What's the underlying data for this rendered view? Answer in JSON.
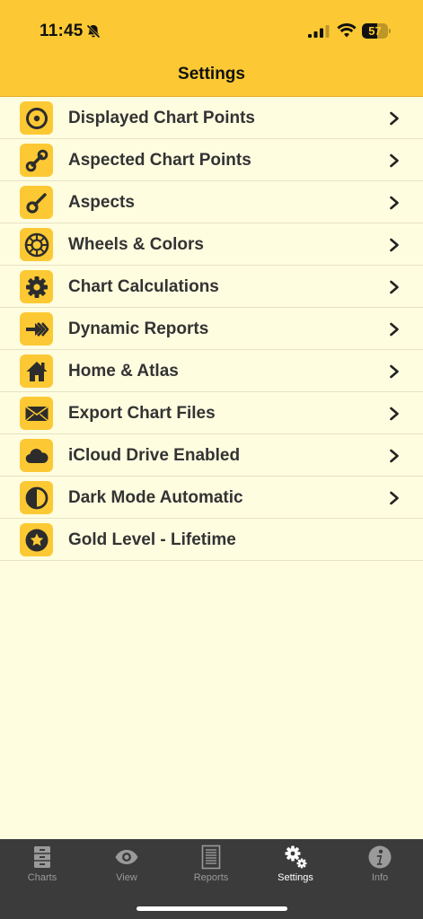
{
  "status_bar": {
    "time": "11:45",
    "battery": "57",
    "battery_level": 0.57,
    "icons": [
      "bell-slash-icon",
      "cellular-signal-icon",
      "wifi-icon",
      "battery-icon"
    ]
  },
  "header": {
    "title": "Settings"
  },
  "settings_items": [
    {
      "label": "Displayed Chart Points",
      "icon": "target-circle-icon",
      "has_chevron": true
    },
    {
      "label": "Aspected Chart Points",
      "icon": "linked-points-icon",
      "has_chevron": true
    },
    {
      "label": "Aspects",
      "icon": "aspect-line-icon",
      "has_chevron": true
    },
    {
      "label": "Wheels & Colors",
      "icon": "wheel-icon",
      "has_chevron": true
    },
    {
      "label": "Chart Calculations",
      "icon": "gear-icon",
      "has_chevron": true
    },
    {
      "label": "Dynamic Reports",
      "icon": "fast-forward-arrow-icon",
      "has_chevron": true
    },
    {
      "label": "Home & Atlas",
      "icon": "house-icon",
      "has_chevron": true
    },
    {
      "label": "Export Chart Files",
      "icon": "envelope-icon",
      "has_chevron": true
    },
    {
      "label": "iCloud Drive Enabled",
      "icon": "cloud-icon",
      "has_chevron": true
    },
    {
      "label": "Dark Mode Automatic",
      "icon": "half-circle-icon",
      "has_chevron": true
    },
    {
      "label": "Gold Level - Lifetime",
      "icon": "star-badge-icon",
      "has_chevron": false
    }
  ],
  "tab_bar": {
    "tabs": [
      {
        "label": "Charts",
        "icon": "file-cabinet-icon",
        "active": false
      },
      {
        "label": "View",
        "icon": "eye-icon",
        "active": false
      },
      {
        "label": "Reports",
        "icon": "document-icon",
        "active": false
      },
      {
        "label": "Settings",
        "icon": "gears-icon",
        "active": true
      },
      {
        "label": "Info",
        "icon": "info-icon",
        "active": false
      }
    ]
  },
  "colors": {
    "accent": "#fcc934",
    "background": "#fffde0",
    "text": "#333333",
    "tab_bar": "#3b3b3b",
    "tab_inactive": "#9a9a9a",
    "tab_active": "#ffffff"
  }
}
